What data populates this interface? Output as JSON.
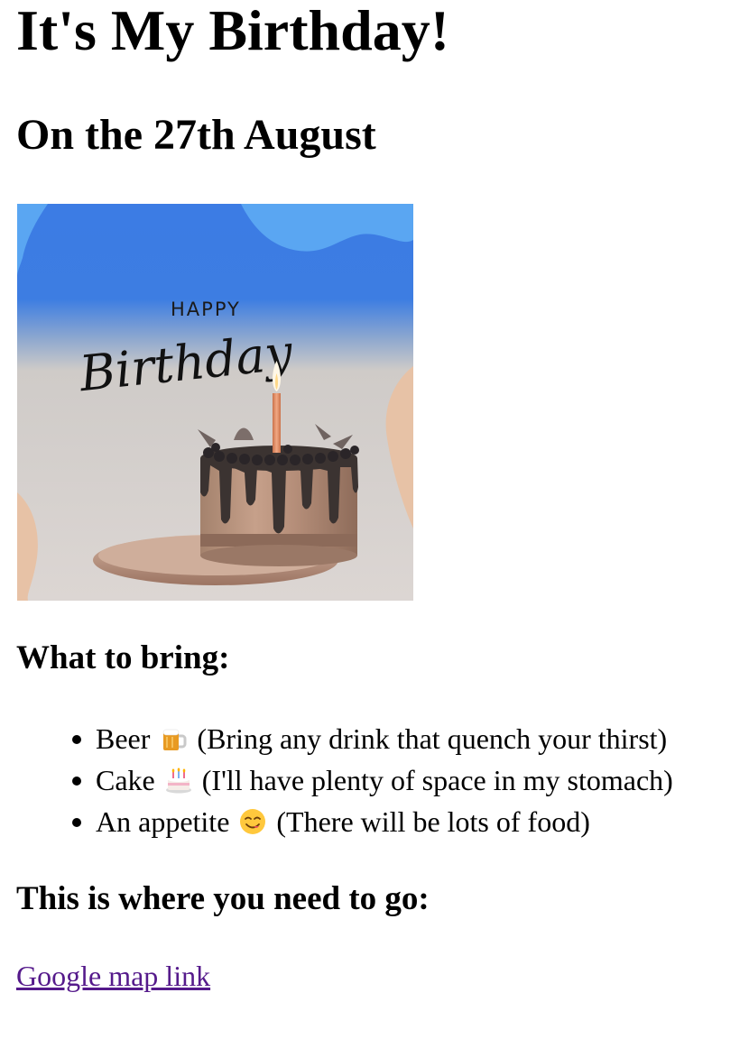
{
  "page": {
    "title": "It's My Birthday!",
    "subtitle": "On the 27th August"
  },
  "hero_image": {
    "happy_text": "HAPPY",
    "birthday_text": "Birthday"
  },
  "bring_section": {
    "heading": "What to bring:",
    "items": [
      {
        "name": "Beer",
        "icon": "beer-mug-icon",
        "note": "(Bring any drink that quench your thirst)"
      },
      {
        "name": "Cake",
        "icon": "birthday-cake-icon",
        "note": "(I'll have plenty of space in my stomach)"
      },
      {
        "name": "An appetite",
        "icon": "yum-face-icon",
        "note": "(There will be lots of food)"
      }
    ]
  },
  "location_section": {
    "heading": "This is where you need to go:",
    "link_text": "Google map link"
  },
  "colors": {
    "link_visited": "#551a8b",
    "sky_blue": "#3f7fe6",
    "peach": "#e7c2a6"
  }
}
